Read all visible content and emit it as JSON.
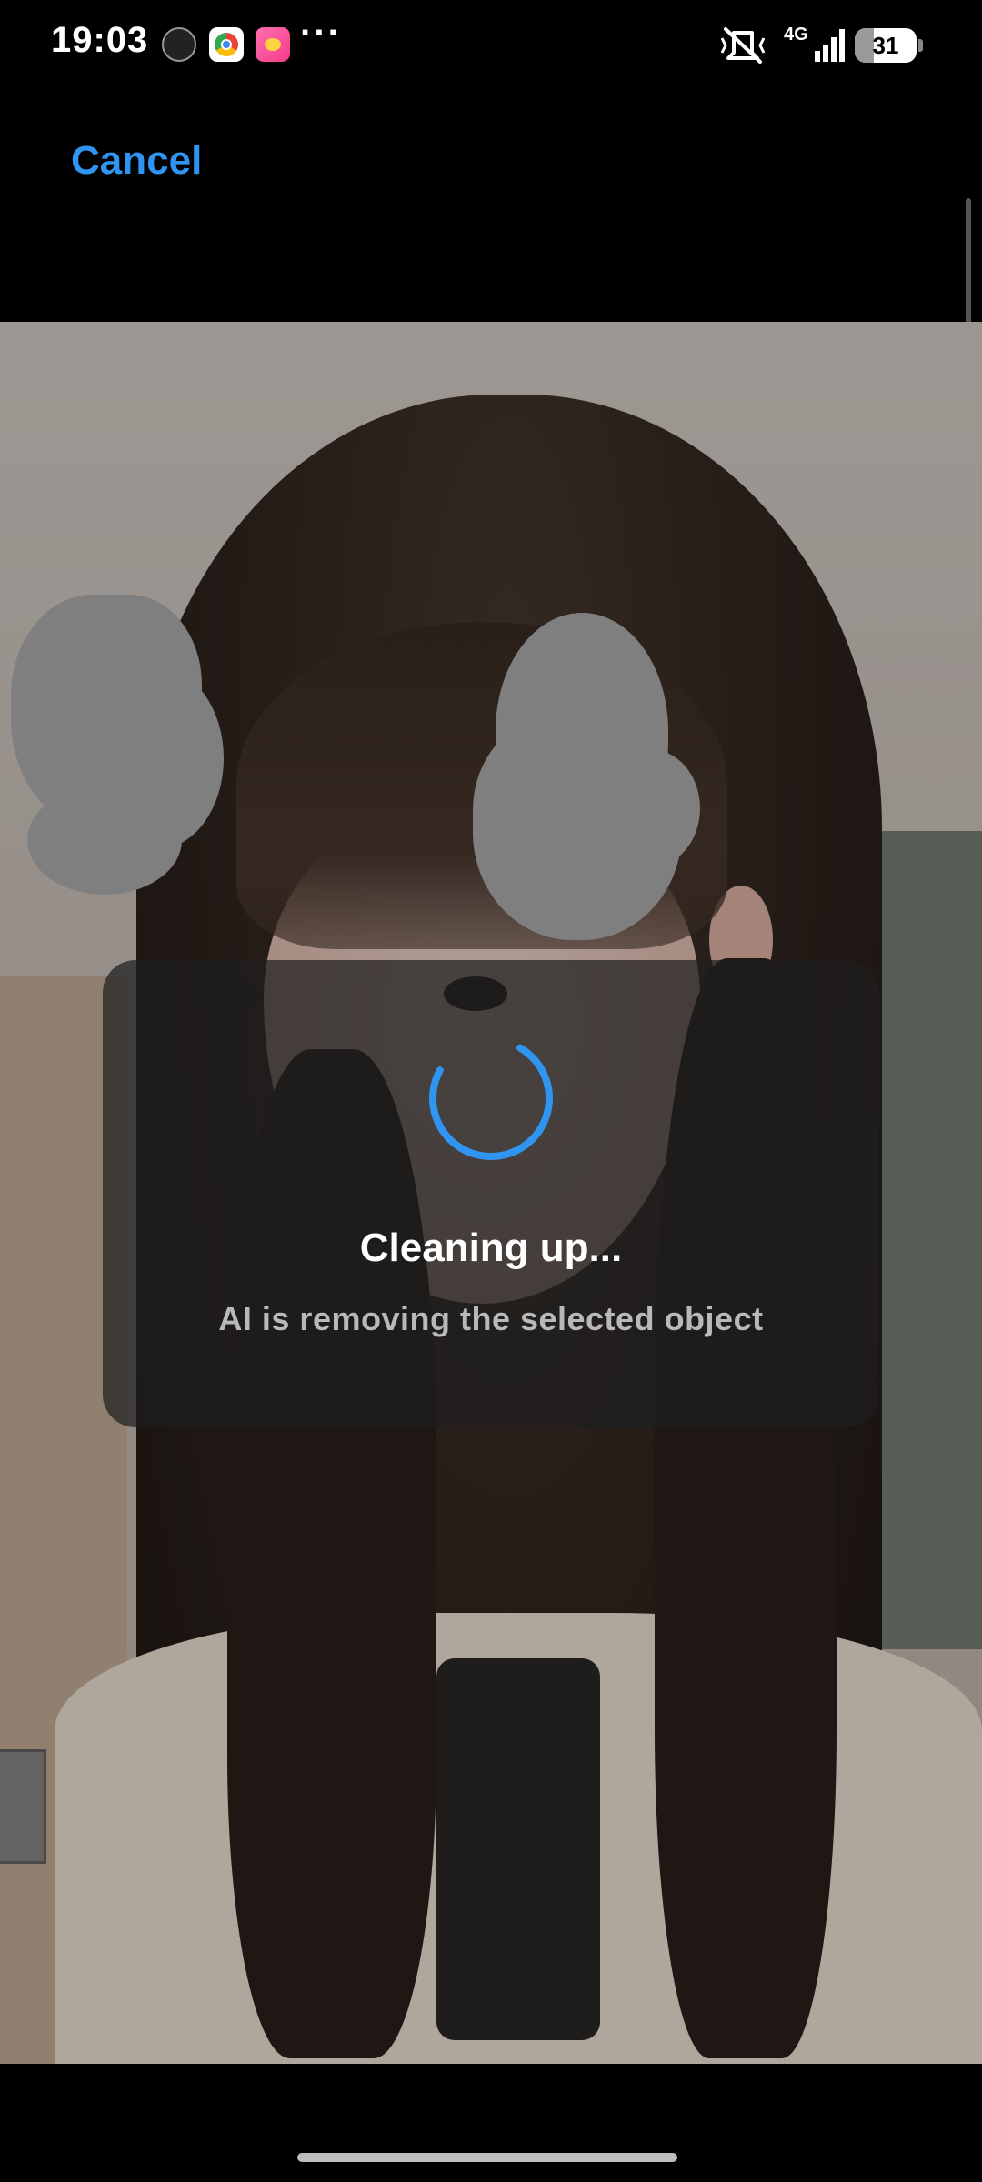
{
  "status_bar": {
    "time": "19:03",
    "more_indicator": "···",
    "network": "4G",
    "battery_percent": "31",
    "battery_level": 0.31,
    "icons": [
      "spiral-app-icon",
      "chrome-icon",
      "pink-app-icon",
      "mute-icon",
      "signal-icon",
      "battery-icon"
    ]
  },
  "top_bar": {
    "cancel_label": "Cancel"
  },
  "loading": {
    "title": "Cleaning up...",
    "subtitle": "AI is removing the selected object",
    "accent_color": "#2f95f0"
  },
  "colors": {
    "background": "#000000",
    "accent": "#2f95f0",
    "mask": "#b1b1b1"
  }
}
